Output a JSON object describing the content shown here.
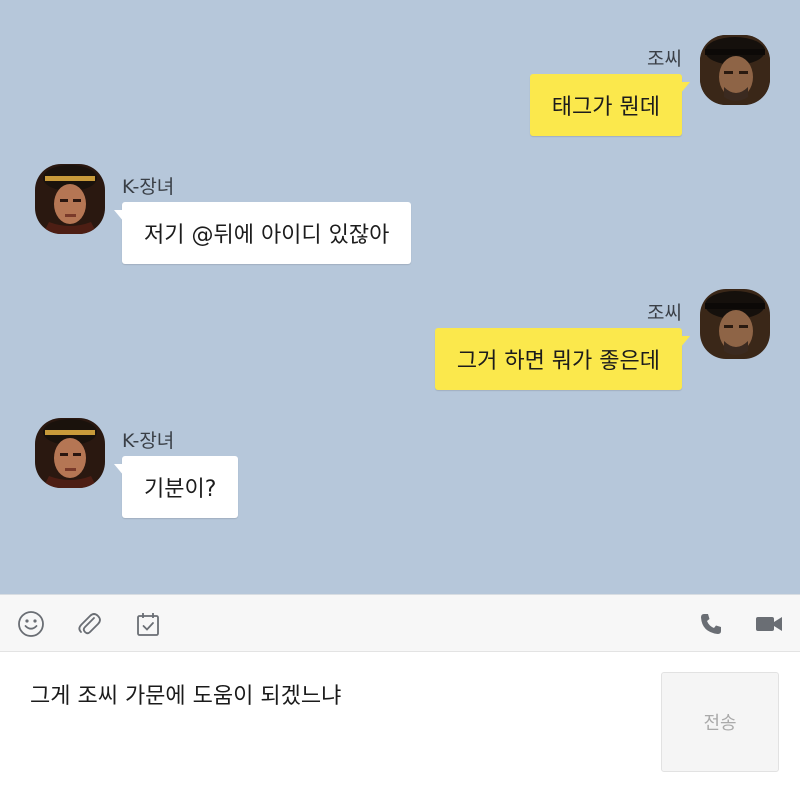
{
  "messages": [
    {
      "sender": "조씨",
      "text": "태그가 뭔데",
      "side": "me"
    },
    {
      "sender": "K-장녀",
      "text": "저기 @뒤에 아이디 있잖아",
      "side": "them"
    },
    {
      "sender": "조씨",
      "text": "그거 하면 뭐가 좋은데",
      "side": "me"
    },
    {
      "sender": "K-장녀",
      "text": "기분이?",
      "side": "them"
    }
  ],
  "toolbar": {
    "icons": [
      "emoji-icon",
      "attachment-icon",
      "calendar-icon",
      "phone-icon",
      "video-call-icon"
    ]
  },
  "composer": {
    "text": "그게 조씨 가문에 도움이 되겠느냐",
    "send_label": "전송"
  },
  "colors": {
    "background": "#b6c7da",
    "my_bubble": "#fbe84c",
    "their_bubble": "#ffffff"
  }
}
